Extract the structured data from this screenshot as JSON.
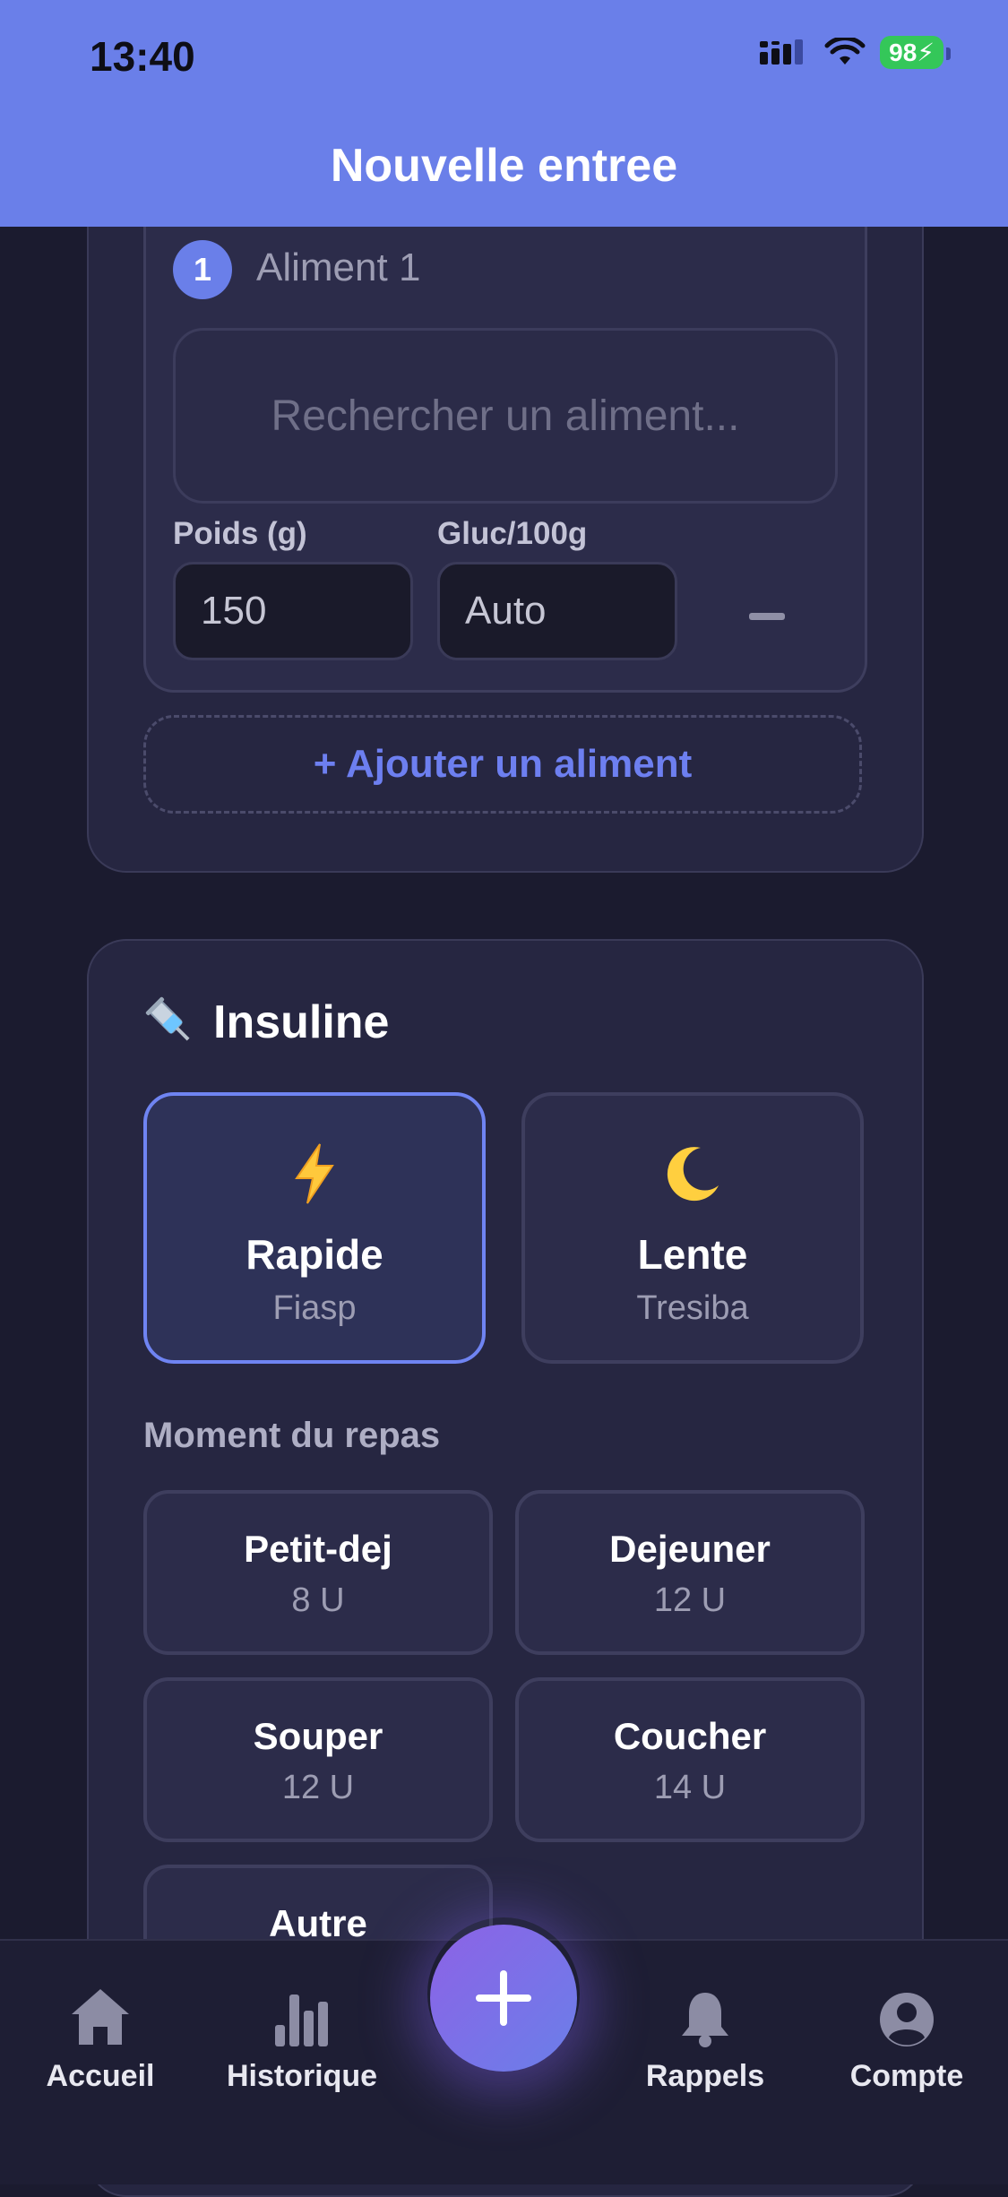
{
  "status_bar": {
    "time": "13:40",
    "battery": "98"
  },
  "header": {
    "title": "Nouvelle entree"
  },
  "food_item": {
    "number": "1",
    "title": "Aliment 1",
    "search_placeholder": "Rechercher un aliment...",
    "weight_label": "Poids (g)",
    "weight_value": "150",
    "carbs_label": "Gluc/100g",
    "carbs_value": "Auto"
  },
  "add_food_label": "+ Ajouter un aliment",
  "insulin": {
    "title": "Insuline",
    "types": [
      {
        "name": "Rapide",
        "brand": "Fiasp",
        "icon": "lightning-icon",
        "selected": true
      },
      {
        "name": "Lente",
        "brand": "Tresiba",
        "icon": "moon-icon",
        "selected": false
      }
    ],
    "moment_label": "Moment du repas",
    "meals": [
      {
        "name": "Petit-dej",
        "dose": "8 U"
      },
      {
        "name": "Dejeuner",
        "dose": "12 U"
      },
      {
        "name": "Souper",
        "dose": "12 U"
      },
      {
        "name": "Coucher",
        "dose": "14 U"
      },
      {
        "name": "Autre"
      }
    ]
  },
  "tabs": [
    {
      "label": "Accueil",
      "icon": "home-icon"
    },
    {
      "label": "Historique",
      "icon": "chart-icon"
    },
    {
      "label": "Rappels",
      "icon": "bell-icon"
    },
    {
      "label": "Compte",
      "icon": "account-icon"
    }
  ],
  "colors": {
    "accent": "#6a7fe9",
    "background": "#1b1b2f",
    "card": "#262641",
    "battery": "#34c759"
  }
}
